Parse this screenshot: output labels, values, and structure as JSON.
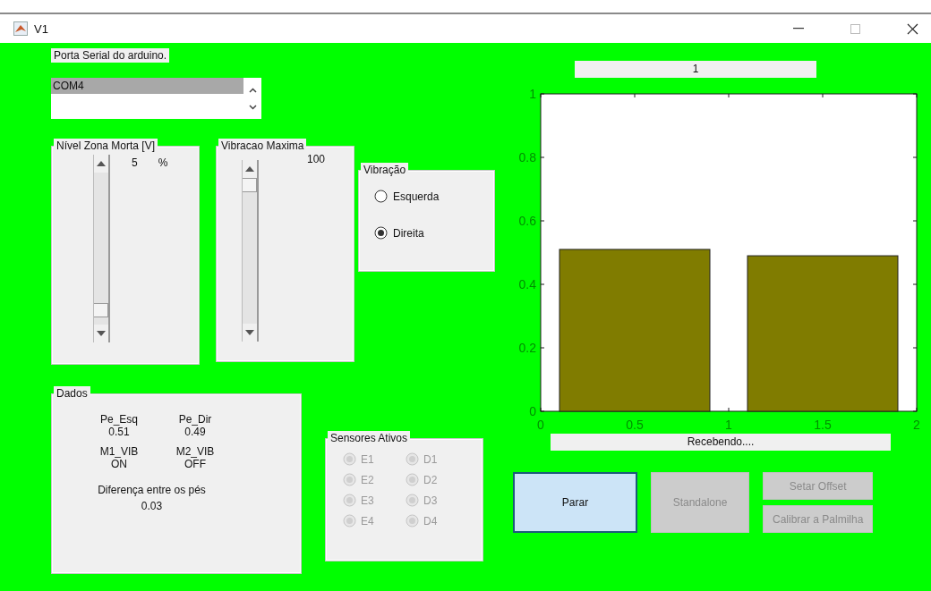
{
  "window": {
    "title": "V1"
  },
  "serial_label": "Porta Serial do arduino.",
  "port_list": {
    "items": [
      {
        "label": "COM4",
        "selected": true
      }
    ]
  },
  "dead_zone_panel": {
    "title": "Nível Zona Morta [V]",
    "slider": {
      "level": 0.05
    },
    "value": "5",
    "unit": "%"
  },
  "max_vibration_panel": {
    "title": "Vibracao Maxima",
    "slider": {
      "level": 1
    },
    "value": "100"
  },
  "vibration_panel": {
    "title": "Vibração",
    "options": [
      {
        "label": "Esquerda",
        "selected": false
      },
      {
        "label": "Direita",
        "selected": true
      }
    ]
  },
  "data_panel": {
    "title": "Dados",
    "readings": [
      {
        "label": "Pe_Esq",
        "value": "0.51"
      },
      {
        "label": "Pe_Dir",
        "value": "0.49"
      },
      {
        "label": "M1_VIB",
        "value": "ON"
      },
      {
        "label": "M2_VIB",
        "value": "OFF"
      }
    ],
    "difference": {
      "label": "Diferença entre os pés",
      "value": "0.03"
    }
  },
  "sensors_panel": {
    "title": "Sensores Ativos",
    "sensors": [
      {
        "label": "E1",
        "selected": false,
        "disabled": true
      },
      {
        "label": "D1",
        "selected": false,
        "disabled": true
      },
      {
        "label": "E2",
        "selected": false,
        "disabled": true
      },
      {
        "label": "D2",
        "selected": false,
        "disabled": true
      },
      {
        "label": "E3",
        "selected": false,
        "disabled": true
      },
      {
        "label": "D3",
        "selected": false,
        "disabled": true
      },
      {
        "label": "E4",
        "selected": false,
        "disabled": true
      },
      {
        "label": "D4",
        "selected": false,
        "disabled": true
      }
    ]
  },
  "chart_title_field": "1",
  "chart": {
    "chart_data": {
      "type": "bar",
      "x": [
        0.5,
        1.5
      ],
      "series": [
        {
          "color": "#807c00",
          "values": [
            0.51,
            0.49
          ]
        }
      ],
      "xlim": [
        0,
        2
      ],
      "ylim": [
        0,
        1
      ],
      "xticks": [
        0,
        0.5,
        1,
        1.5,
        2
      ],
      "yticks": [
        0,
        0.2,
        0.4,
        0.6,
        0.8,
        1
      ]
    }
  },
  "status_field": "Recebendo....",
  "buttons": [
    {
      "label": "Parar",
      "kind": "large",
      "disabled": false,
      "focused": true
    },
    {
      "label": "Standalone",
      "kind": "large",
      "disabled": true,
      "focused": false
    },
    {
      "label": "Setar Offset",
      "kind": "small",
      "disabled": true,
      "focused": false
    },
    {
      "label": "Calibrar a Palmilha",
      "kind": "small",
      "disabled": true,
      "focused": false
    }
  ]
}
